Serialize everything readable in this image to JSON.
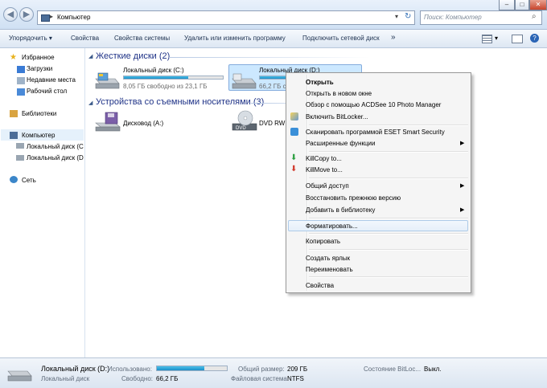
{
  "address": {
    "path": "Компьютер",
    "search_placeholder": "Поиск: Компьютер"
  },
  "toolbar": {
    "organize": "Упорядочить ▾",
    "properties": "Свойства",
    "system_properties": "Свойства системы",
    "uninstall": "Удалить или изменить программу",
    "map_drive": "Подключить сетевой диск",
    "more": "»"
  },
  "nav": {
    "favorites": "Избранное",
    "downloads": "Загрузки",
    "recent": "Недавние места",
    "desktop": "Рабочий стол",
    "libraries": "Библиотеки",
    "computer": "Компьютер",
    "drive_c": "Локальный диск (C",
    "drive_d": "Локальный диск (D",
    "network": "Сеть"
  },
  "groups": {
    "hard_disks": "Жесткие диски (2)",
    "removable": "Устройства со съемными носителями (3)"
  },
  "drives": {
    "c": {
      "name": "Локальный диск (C:)",
      "free": "8,05 ГБ свободно из 23,1 ГБ",
      "used_fraction": 0.65
    },
    "d": {
      "name": "Локальный диск (D:)",
      "free": "66,2 ГБ с",
      "used_fraction": 0.68
    },
    "floppy": {
      "name": "Дисковод (A:)"
    },
    "dvd": {
      "name": "DVD RW д",
      "icon_label": "DVD"
    }
  },
  "context_menu": {
    "open": "Открыть",
    "open_new": "Открыть в новом окне",
    "acdsee": "Обзор с помощью ACDSee 10 Photo Manager",
    "bitlocker": "Включить BitLocker...",
    "eset": "Сканировать программой ESET Smart Security",
    "extended": "Расширенные функции",
    "killcopy": "KillCopy to...",
    "killmove": "KillMove to...",
    "sharing": "Общий доступ",
    "restore": "Восстановить прежнюю версию",
    "library": "Добавить в библиотеку",
    "format": "Форматировать...",
    "copy": "Копировать",
    "shortcut": "Создать ярлык",
    "rename": "Переименовать",
    "properties": "Свойства"
  },
  "status": {
    "name": "Локальный диск (D:)",
    "type": "Локальный диск",
    "used_label": "Использовано:",
    "free_label": "Свободно:",
    "free_value": "66,2 ГБ",
    "total_label": "Общий размер:",
    "total_value": "209 ГБ",
    "fs_label": "Файловая система:",
    "fs_value": "NTFS",
    "bitlocker_label": "Состояние BitLoc...",
    "bitlocker_value": "Выкл.",
    "used_fraction": 0.68
  },
  "colors": {
    "accent": "#1e3287",
    "bar_fill": "#26a0da",
    "selection": "#cce8ff"
  }
}
